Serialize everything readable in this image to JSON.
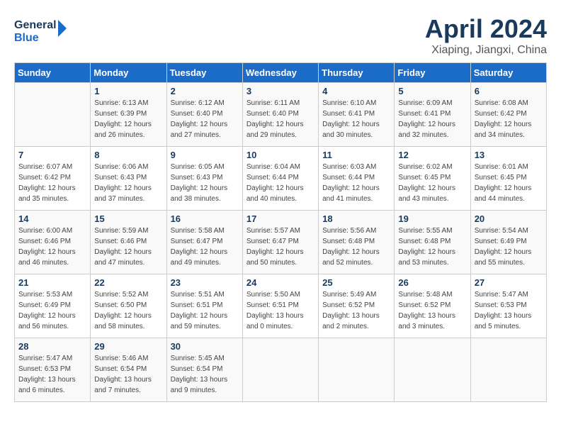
{
  "header": {
    "logo_general": "General",
    "logo_blue": "Blue",
    "month_title": "April 2024",
    "location": "Xiaping, Jiangxi, China"
  },
  "weekdays": [
    "Sunday",
    "Monday",
    "Tuesday",
    "Wednesday",
    "Thursday",
    "Friday",
    "Saturday"
  ],
  "weeks": [
    [
      {
        "day": "",
        "sunrise": "",
        "sunset": "",
        "daylight": ""
      },
      {
        "day": "1",
        "sunrise": "Sunrise: 6:13 AM",
        "sunset": "Sunset: 6:39 PM",
        "daylight": "Daylight: 12 hours and 26 minutes."
      },
      {
        "day": "2",
        "sunrise": "Sunrise: 6:12 AM",
        "sunset": "Sunset: 6:40 PM",
        "daylight": "Daylight: 12 hours and 27 minutes."
      },
      {
        "day": "3",
        "sunrise": "Sunrise: 6:11 AM",
        "sunset": "Sunset: 6:40 PM",
        "daylight": "Daylight: 12 hours and 29 minutes."
      },
      {
        "day": "4",
        "sunrise": "Sunrise: 6:10 AM",
        "sunset": "Sunset: 6:41 PM",
        "daylight": "Daylight: 12 hours and 30 minutes."
      },
      {
        "day": "5",
        "sunrise": "Sunrise: 6:09 AM",
        "sunset": "Sunset: 6:41 PM",
        "daylight": "Daylight: 12 hours and 32 minutes."
      },
      {
        "day": "6",
        "sunrise": "Sunrise: 6:08 AM",
        "sunset": "Sunset: 6:42 PM",
        "daylight": "Daylight: 12 hours and 34 minutes."
      }
    ],
    [
      {
        "day": "7",
        "sunrise": "Sunrise: 6:07 AM",
        "sunset": "Sunset: 6:42 PM",
        "daylight": "Daylight: 12 hours and 35 minutes."
      },
      {
        "day": "8",
        "sunrise": "Sunrise: 6:06 AM",
        "sunset": "Sunset: 6:43 PM",
        "daylight": "Daylight: 12 hours and 37 minutes."
      },
      {
        "day": "9",
        "sunrise": "Sunrise: 6:05 AM",
        "sunset": "Sunset: 6:43 PM",
        "daylight": "Daylight: 12 hours and 38 minutes."
      },
      {
        "day": "10",
        "sunrise": "Sunrise: 6:04 AM",
        "sunset": "Sunset: 6:44 PM",
        "daylight": "Daylight: 12 hours and 40 minutes."
      },
      {
        "day": "11",
        "sunrise": "Sunrise: 6:03 AM",
        "sunset": "Sunset: 6:44 PM",
        "daylight": "Daylight: 12 hours and 41 minutes."
      },
      {
        "day": "12",
        "sunrise": "Sunrise: 6:02 AM",
        "sunset": "Sunset: 6:45 PM",
        "daylight": "Daylight: 12 hours and 43 minutes."
      },
      {
        "day": "13",
        "sunrise": "Sunrise: 6:01 AM",
        "sunset": "Sunset: 6:45 PM",
        "daylight": "Daylight: 12 hours and 44 minutes."
      }
    ],
    [
      {
        "day": "14",
        "sunrise": "Sunrise: 6:00 AM",
        "sunset": "Sunset: 6:46 PM",
        "daylight": "Daylight: 12 hours and 46 minutes."
      },
      {
        "day": "15",
        "sunrise": "Sunrise: 5:59 AM",
        "sunset": "Sunset: 6:46 PM",
        "daylight": "Daylight: 12 hours and 47 minutes."
      },
      {
        "day": "16",
        "sunrise": "Sunrise: 5:58 AM",
        "sunset": "Sunset: 6:47 PM",
        "daylight": "Daylight: 12 hours and 49 minutes."
      },
      {
        "day": "17",
        "sunrise": "Sunrise: 5:57 AM",
        "sunset": "Sunset: 6:47 PM",
        "daylight": "Daylight: 12 hours and 50 minutes."
      },
      {
        "day": "18",
        "sunrise": "Sunrise: 5:56 AM",
        "sunset": "Sunset: 6:48 PM",
        "daylight": "Daylight: 12 hours and 52 minutes."
      },
      {
        "day": "19",
        "sunrise": "Sunrise: 5:55 AM",
        "sunset": "Sunset: 6:48 PM",
        "daylight": "Daylight: 12 hours and 53 minutes."
      },
      {
        "day": "20",
        "sunrise": "Sunrise: 5:54 AM",
        "sunset": "Sunset: 6:49 PM",
        "daylight": "Daylight: 12 hours and 55 minutes."
      }
    ],
    [
      {
        "day": "21",
        "sunrise": "Sunrise: 5:53 AM",
        "sunset": "Sunset: 6:49 PM",
        "daylight": "Daylight: 12 hours and 56 minutes."
      },
      {
        "day": "22",
        "sunrise": "Sunrise: 5:52 AM",
        "sunset": "Sunset: 6:50 PM",
        "daylight": "Daylight: 12 hours and 58 minutes."
      },
      {
        "day": "23",
        "sunrise": "Sunrise: 5:51 AM",
        "sunset": "Sunset: 6:51 PM",
        "daylight": "Daylight: 12 hours and 59 minutes."
      },
      {
        "day": "24",
        "sunrise": "Sunrise: 5:50 AM",
        "sunset": "Sunset: 6:51 PM",
        "daylight": "Daylight: 13 hours and 0 minutes."
      },
      {
        "day": "25",
        "sunrise": "Sunrise: 5:49 AM",
        "sunset": "Sunset: 6:52 PM",
        "daylight": "Daylight: 13 hours and 2 minutes."
      },
      {
        "day": "26",
        "sunrise": "Sunrise: 5:48 AM",
        "sunset": "Sunset: 6:52 PM",
        "daylight": "Daylight: 13 hours and 3 minutes."
      },
      {
        "day": "27",
        "sunrise": "Sunrise: 5:47 AM",
        "sunset": "Sunset: 6:53 PM",
        "daylight": "Daylight: 13 hours and 5 minutes."
      }
    ],
    [
      {
        "day": "28",
        "sunrise": "Sunrise: 5:47 AM",
        "sunset": "Sunset: 6:53 PM",
        "daylight": "Daylight: 13 hours and 6 minutes."
      },
      {
        "day": "29",
        "sunrise": "Sunrise: 5:46 AM",
        "sunset": "Sunset: 6:54 PM",
        "daylight": "Daylight: 13 hours and 7 minutes."
      },
      {
        "day": "30",
        "sunrise": "Sunrise: 5:45 AM",
        "sunset": "Sunset: 6:54 PM",
        "daylight": "Daylight: 13 hours and 9 minutes."
      },
      {
        "day": "",
        "sunrise": "",
        "sunset": "",
        "daylight": ""
      },
      {
        "day": "",
        "sunrise": "",
        "sunset": "",
        "daylight": ""
      },
      {
        "day": "",
        "sunrise": "",
        "sunset": "",
        "daylight": ""
      },
      {
        "day": "",
        "sunrise": "",
        "sunset": "",
        "daylight": ""
      }
    ]
  ]
}
